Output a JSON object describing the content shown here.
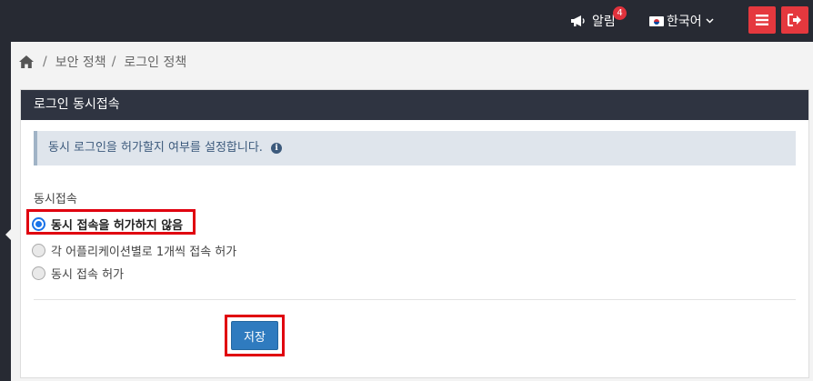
{
  "header": {
    "alarm_label": "알림",
    "alarm_count": "4",
    "language_label": "한국어"
  },
  "breadcrumb": {
    "items": [
      "보안 정책",
      "로그인 정책"
    ]
  },
  "panel": {
    "title": "로그인 동시접속",
    "info_text": "동시 로그인을 허가할지 여부를 설정합니다.",
    "field_label": "동시접속",
    "options": [
      {
        "label": "동시 접속을 허가하지 않음",
        "checked": true
      },
      {
        "label": "각 어플리케이션별로 1개씩 접속 허가",
        "checked": false
      },
      {
        "label": "동시 접속 허가",
        "checked": false
      }
    ],
    "save_label": "저장"
  },
  "colors": {
    "topbar": "#272a33",
    "accent_red": "#e5383e",
    "primary_blue": "#2f7bbf",
    "highlight": "#e0000f"
  },
  "icons": [
    "megaphone-icon",
    "korea-flag-icon",
    "chevron-down-icon",
    "menu-icon",
    "logout-icon",
    "home-icon",
    "info-icon"
  ]
}
